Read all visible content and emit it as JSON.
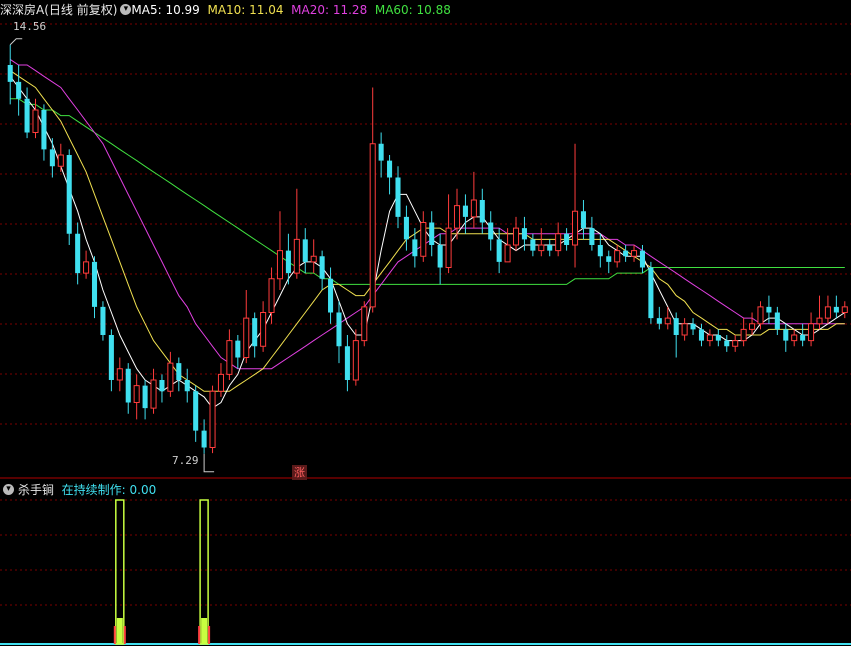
{
  "header": {
    "stock_name": "深深房A",
    "period": "(日线 前复权)",
    "ma5_label": "MA5: 10.99",
    "ma10_label": "MA10: 11.04",
    "ma20_label": "MA20: 11.28",
    "ma60_label": "MA60: 10.88"
  },
  "indicator_panel": {
    "name": "杀手锏",
    "value_label": "在持续制作: 0.00"
  },
  "marks": {
    "high_label": "14.56",
    "low_label": "7.29",
    "limit_up_tag": "涨"
  },
  "colors": {
    "up": "#ff3c3c",
    "down": "#40e0f0",
    "ma5": "#ffffff",
    "ma10": "#f0e050",
    "ma20": "#e040e0",
    "ma60": "#40e040",
    "grid": "#7a0000",
    "indicator_bar": "#c8ff40",
    "indicator_base": "#ff4040"
  },
  "chart_data": [
    {
      "type": "candlestick",
      "title": "深深房A (日线 前复权)",
      "ylim": [
        7.0,
        15.0
      ],
      "high": 14.56,
      "low": 7.29,
      "candles": [
        [
          14.2,
          13.9,
          14.56,
          13.5
        ],
        [
          13.9,
          13.6,
          14.2,
          13.3
        ],
        [
          13.6,
          13.0,
          13.8,
          12.9
        ],
        [
          13.0,
          13.4,
          13.6,
          12.9
        ],
        [
          13.4,
          12.7,
          13.5,
          12.5
        ],
        [
          12.7,
          12.4,
          12.9,
          12.2
        ],
        [
          12.4,
          12.6,
          12.8,
          12.3
        ],
        [
          12.6,
          11.2,
          12.7,
          11.0
        ],
        [
          11.2,
          10.5,
          11.4,
          10.3
        ],
        [
          10.5,
          10.7,
          10.9,
          10.4
        ],
        [
          10.7,
          9.9,
          10.8,
          9.7
        ],
        [
          9.9,
          9.4,
          10.0,
          9.3
        ],
        [
          9.4,
          8.6,
          9.5,
          8.4
        ],
        [
          8.6,
          8.8,
          9.0,
          8.4
        ],
        [
          8.8,
          8.2,
          8.9,
          8.0
        ],
        [
          8.2,
          8.5,
          8.7,
          7.9
        ],
        [
          8.5,
          8.1,
          8.6,
          7.9
        ],
        [
          8.1,
          8.6,
          8.8,
          8.0
        ],
        [
          8.6,
          8.4,
          8.7,
          8.2
        ],
        [
          8.4,
          8.9,
          9.1,
          8.3
        ],
        [
          8.9,
          8.6,
          9.0,
          8.4
        ],
        [
          8.6,
          8.4,
          8.8,
          8.2
        ],
        [
          8.4,
          7.7,
          8.5,
          7.5
        ],
        [
          7.7,
          7.4,
          7.9,
          7.29
        ],
        [
          7.4,
          8.4,
          8.5,
          7.3
        ],
        [
          8.4,
          8.7,
          8.9,
          8.3
        ],
        [
          8.7,
          9.3,
          9.5,
          8.6
        ],
        [
          9.3,
          9.0,
          9.4,
          8.8
        ],
        [
          9.0,
          9.7,
          10.2,
          8.9
        ],
        [
          9.7,
          9.2,
          9.8,
          9.0
        ],
        [
          9.2,
          9.8,
          10.0,
          9.1
        ],
        [
          9.8,
          10.4,
          10.6,
          9.6
        ],
        [
          10.4,
          10.9,
          11.6,
          10.2
        ],
        [
          10.9,
          10.5,
          11.2,
          10.3
        ],
        [
          10.5,
          11.1,
          12.0,
          10.4
        ],
        [
          11.1,
          10.7,
          11.3,
          10.5
        ],
        [
          10.7,
          10.8,
          11.1,
          10.5
        ],
        [
          10.8,
          10.4,
          10.9,
          10.2
        ],
        [
          10.4,
          9.8,
          10.6,
          9.6
        ],
        [
          9.8,
          9.2,
          10.0,
          8.9
        ],
        [
          9.2,
          8.6,
          9.4,
          8.4
        ],
        [
          8.6,
          9.3,
          9.5,
          8.5
        ],
        [
          9.3,
          9.9,
          10.0,
          9.2
        ],
        [
          9.9,
          12.8,
          13.8,
          9.8
        ],
        [
          12.8,
          12.5,
          13.0,
          12.2
        ],
        [
          12.5,
          12.2,
          12.6,
          11.9
        ],
        [
          12.2,
          11.5,
          12.4,
          11.3
        ],
        [
          11.5,
          11.1,
          11.7,
          10.9
        ],
        [
          11.1,
          10.8,
          11.3,
          10.6
        ],
        [
          10.8,
          11.4,
          11.6,
          10.7
        ],
        [
          11.4,
          11.0,
          11.6,
          10.8
        ],
        [
          11.0,
          10.6,
          11.2,
          10.3
        ],
        [
          10.6,
          11.3,
          11.9,
          10.5
        ],
        [
          11.3,
          11.7,
          12.0,
          11.1
        ],
        [
          11.7,
          11.5,
          11.9,
          11.2
        ],
        [
          11.5,
          11.8,
          12.3,
          11.3
        ],
        [
          11.8,
          11.4,
          12.0,
          11.2
        ],
        [
          11.4,
          11.1,
          11.6,
          10.9
        ],
        [
          11.1,
          10.7,
          11.3,
          10.5
        ],
        [
          10.7,
          11.0,
          11.3,
          10.9
        ],
        [
          11.0,
          11.3,
          11.5,
          10.9
        ],
        [
          11.3,
          11.1,
          11.5,
          10.9
        ],
        [
          11.1,
          10.9,
          11.2,
          10.8
        ],
        [
          10.9,
          11.0,
          11.3,
          10.8
        ],
        [
          11.0,
          10.9,
          11.1,
          10.8
        ],
        [
          10.9,
          11.2,
          11.4,
          10.8
        ],
        [
          11.2,
          11.0,
          11.3,
          10.9
        ],
        [
          11.0,
          11.6,
          12.8,
          10.6
        ],
        [
          11.6,
          11.3,
          11.8,
          11.1
        ],
        [
          11.3,
          11.0,
          11.5,
          10.9
        ],
        [
          11.0,
          10.8,
          11.2,
          10.6
        ],
        [
          10.8,
          10.7,
          10.9,
          10.5
        ],
        [
          10.7,
          10.9,
          11.0,
          10.6
        ],
        [
          10.9,
          10.8,
          11.0,
          10.7
        ],
        [
          10.8,
          10.9,
          11.0,
          10.7
        ],
        [
          10.9,
          10.6,
          11.0,
          10.5
        ],
        [
          10.6,
          9.7,
          10.7,
          9.6
        ],
        [
          9.7,
          9.6,
          9.9,
          9.5
        ],
        [
          9.6,
          9.7,
          9.9,
          9.5
        ],
        [
          9.7,
          9.4,
          9.8,
          9.0
        ],
        [
          9.4,
          9.6,
          9.7,
          9.3
        ],
        [
          9.6,
          9.5,
          9.7,
          9.4
        ],
        [
          9.5,
          9.3,
          9.6,
          9.2
        ],
        [
          9.3,
          9.4,
          9.5,
          9.2
        ],
        [
          9.4,
          9.3,
          9.5,
          9.2
        ],
        [
          9.3,
          9.2,
          9.4,
          9.1
        ],
        [
          9.2,
          9.3,
          9.4,
          9.1
        ],
        [
          9.3,
          9.5,
          9.7,
          9.2
        ],
        [
          9.5,
          9.6,
          9.8,
          9.4
        ],
        [
          9.6,
          9.9,
          10.0,
          9.5
        ],
        [
          9.9,
          9.8,
          10.1,
          9.6
        ],
        [
          9.8,
          9.5,
          9.9,
          9.4
        ],
        [
          9.5,
          9.3,
          9.6,
          9.1
        ],
        [
          9.3,
          9.4,
          9.5,
          9.2
        ],
        [
          9.4,
          9.3,
          9.6,
          9.2
        ],
        [
          9.3,
          9.6,
          9.8,
          9.2
        ],
        [
          9.6,
          9.7,
          10.1,
          9.5
        ],
        [
          9.7,
          9.9,
          10.1,
          9.6
        ],
        [
          9.9,
          9.8,
          10.1,
          9.7
        ],
        [
          9.8,
          9.9,
          10.0,
          9.7
        ]
      ],
      "ma5": [
        14.0,
        13.8,
        13.6,
        13.4,
        13.1,
        12.8,
        12.4,
        12.0,
        11.6,
        11.1,
        10.7,
        10.2,
        9.8,
        9.4,
        9.1,
        8.8,
        8.6,
        8.5,
        8.4,
        8.5,
        8.6,
        8.5,
        8.4,
        8.3,
        8.1,
        8.2,
        8.5,
        8.7,
        9.1,
        9.3,
        9.5,
        9.8,
        10.1,
        10.4,
        10.6,
        10.7,
        10.7,
        10.6,
        10.4,
        10.0,
        9.6,
        9.4,
        9.4,
        10.1,
        10.9,
        11.6,
        11.9,
        11.9,
        11.6,
        11.3,
        11.1,
        11.0,
        11.0,
        11.2,
        11.4,
        11.5,
        11.5,
        11.3,
        11.1,
        11.0,
        10.9,
        11.0,
        11.0,
        11.0,
        11.0,
        11.0,
        11.1,
        11.2,
        11.3,
        11.3,
        11.2,
        11.0,
        10.9,
        10.8,
        10.8,
        10.8,
        10.5,
        10.2,
        9.9,
        9.6,
        9.6,
        9.6,
        9.5,
        9.4,
        9.4,
        9.3,
        9.3,
        9.3,
        9.4,
        9.6,
        9.7,
        9.7,
        9.6,
        9.5,
        9.4,
        9.4,
        9.5,
        9.6,
        9.7,
        9.8
      ],
      "ma10": [
        14.1,
        14.0,
        13.9,
        13.8,
        13.6,
        13.4,
        13.2,
        12.9,
        12.6,
        12.3,
        11.9,
        11.5,
        11.1,
        10.7,
        10.3,
        9.9,
        9.6,
        9.3,
        9.1,
        8.9,
        8.7,
        8.6,
        8.5,
        8.4,
        8.4,
        8.4,
        8.4,
        8.5,
        8.6,
        8.7,
        8.8,
        9.0,
        9.2,
        9.4,
        9.6,
        9.8,
        10.0,
        10.2,
        10.3,
        10.3,
        10.2,
        10.1,
        10.1,
        10.3,
        10.5,
        10.7,
        10.9,
        11.1,
        11.2,
        11.3,
        11.3,
        11.3,
        11.2,
        11.2,
        11.2,
        11.2,
        11.2,
        11.2,
        11.2,
        11.2,
        11.2,
        11.2,
        11.1,
        11.1,
        11.1,
        11.1,
        11.1,
        11.1,
        11.1,
        11.1,
        11.1,
        11.1,
        11.0,
        10.9,
        10.8,
        10.7,
        10.6,
        10.4,
        10.3,
        10.1,
        10.0,
        9.8,
        9.7,
        9.6,
        9.5,
        9.5,
        9.4,
        9.4,
        9.4,
        9.4,
        9.5,
        9.5,
        9.5,
        9.5,
        9.5,
        9.5,
        9.5,
        9.5,
        9.6,
        9.6
      ],
      "ma20": [
        14.3,
        14.2,
        14.2,
        14.1,
        14.0,
        13.9,
        13.8,
        13.6,
        13.4,
        13.2,
        13.0,
        12.8,
        12.5,
        12.2,
        11.9,
        11.6,
        11.3,
        11.0,
        10.7,
        10.4,
        10.1,
        9.9,
        9.6,
        9.4,
        9.2,
        9.0,
        8.9,
        8.8,
        8.8,
        8.8,
        8.8,
        8.8,
        8.9,
        9.0,
        9.1,
        9.2,
        9.3,
        9.4,
        9.5,
        9.6,
        9.7,
        9.8,
        9.9,
        10.1,
        10.3,
        10.5,
        10.7,
        10.8,
        10.9,
        11.0,
        11.1,
        11.2,
        11.2,
        11.3,
        11.3,
        11.3,
        11.3,
        11.3,
        11.3,
        11.2,
        11.2,
        11.2,
        11.2,
        11.2,
        11.2,
        11.2,
        11.2,
        11.2,
        11.2,
        11.2,
        11.2,
        11.1,
        11.1,
        11.0,
        11.0,
        10.9,
        10.8,
        10.7,
        10.6,
        10.5,
        10.4,
        10.3,
        10.2,
        10.1,
        10.0,
        9.9,
        9.8,
        9.7,
        9.7,
        9.6,
        9.6,
        9.6,
        9.6,
        9.6,
        9.6,
        9.6,
        9.6,
        9.6,
        9.6,
        9.6
      ],
      "ma60": [
        13.6,
        13.6,
        13.5,
        13.5,
        13.4,
        13.4,
        13.3,
        13.3,
        13.2,
        13.1,
        13.0,
        12.9,
        12.8,
        12.7,
        12.6,
        12.5,
        12.4,
        12.3,
        12.2,
        12.1,
        12.0,
        11.9,
        11.8,
        11.7,
        11.6,
        11.5,
        11.4,
        11.3,
        11.2,
        11.1,
        11.0,
        10.9,
        10.8,
        10.7,
        10.6,
        10.5,
        10.5,
        10.4,
        10.4,
        10.3,
        10.3,
        10.3,
        10.3,
        10.3,
        10.3,
        10.3,
        10.3,
        10.3,
        10.3,
        10.3,
        10.3,
        10.3,
        10.3,
        10.3,
        10.3,
        10.3,
        10.3,
        10.3,
        10.3,
        10.3,
        10.3,
        10.3,
        10.3,
        10.3,
        10.3,
        10.3,
        10.3,
        10.4,
        10.4,
        10.4,
        10.4,
        10.4,
        10.5,
        10.5,
        10.5,
        10.5,
        10.6,
        10.6,
        10.6,
        10.6,
        10.6,
        10.6,
        10.6,
        10.6,
        10.6,
        10.6,
        10.6,
        10.6,
        10.6,
        10.6,
        10.6,
        10.6,
        10.6,
        10.6,
        10.6,
        10.6,
        10.6,
        10.6,
        10.6,
        10.6
      ]
    },
    {
      "type": "bar",
      "title": "杀手锏",
      "signal_indices": [
        13,
        23
      ],
      "value": 0.0
    }
  ]
}
